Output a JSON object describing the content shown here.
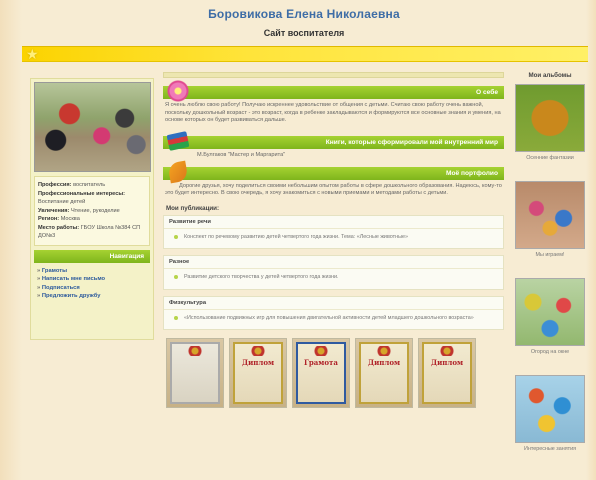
{
  "header": {
    "owner_name": "Боровикова Елена Николаевна",
    "site_title": "Сайт воспитателя"
  },
  "profile": {
    "rows": [
      {
        "label": "Профессия:",
        "value": "воспитатель"
      },
      {
        "label": "Профессиональные интересы:",
        "value": "Воспитание детей"
      },
      {
        "label": "Увлечения:",
        "value": "Чтение, рукоделие"
      },
      {
        "label": "Регион:",
        "value": "Москва"
      },
      {
        "label": "Место работы:",
        "value": "ГБОУ Школа №384 СП ДО№3"
      }
    ]
  },
  "navigation": {
    "title": "Навигация",
    "items": [
      "Грамоты",
      "Написать мне письмо",
      "Подписаться",
      "Предложить дружбу"
    ]
  },
  "about": {
    "title": "О себе",
    "text": "Я очень люблю свою работу! Получаю искреннее удовольствие от общения с детьми. Считаю свою работу очень важной, поскольку дошкольный возраст - это возраст, когда в ребенке закладываются и формируются все основные знания и умения, на основе которых он будет развиваться дальше."
  },
  "books": {
    "title": "Книги, которые сформировали мой внутренний мир",
    "item": "М.Булгаков \"Мастер и Маргарита\""
  },
  "portfolio": {
    "title": "Моё портфолио",
    "text": "Дорогие друзья, хочу поделиться своими небольшим опытом работы в сфере дошкольного образования. Надеюсь, кому-то это будет интересно. В свою очередь, я хочу знакомиться с новыми приемами и методами работы с детьми."
  },
  "publications": {
    "title": "Мои публикации:",
    "groups": [
      {
        "category": "Развитие речи",
        "item": "Конспект по речевому развитию детей четвертого года жизни. Тема: «Лесные животные»"
      },
      {
        "category": "Разное",
        "item": "Развитие детского творчества у детей четвертого года жизни."
      },
      {
        "category": "Физкультура",
        "item": "«Использование подвижных игр для повышения двигательной активности детей младшего дошкольного возраста»"
      }
    ]
  },
  "diplomas": [
    {
      "label": ""
    },
    {
      "label": "Диплом"
    },
    {
      "label": "Грамота"
    },
    {
      "label": "Диплом"
    },
    {
      "label": "Диплом"
    }
  ],
  "albums": {
    "title": "Мои альбомы",
    "items": [
      {
        "caption": "Осенние фантазии"
      },
      {
        "caption": "Мы играем!"
      },
      {
        "caption": "Огород на окне"
      },
      {
        "caption": "Интересные занятия"
      }
    ]
  }
}
